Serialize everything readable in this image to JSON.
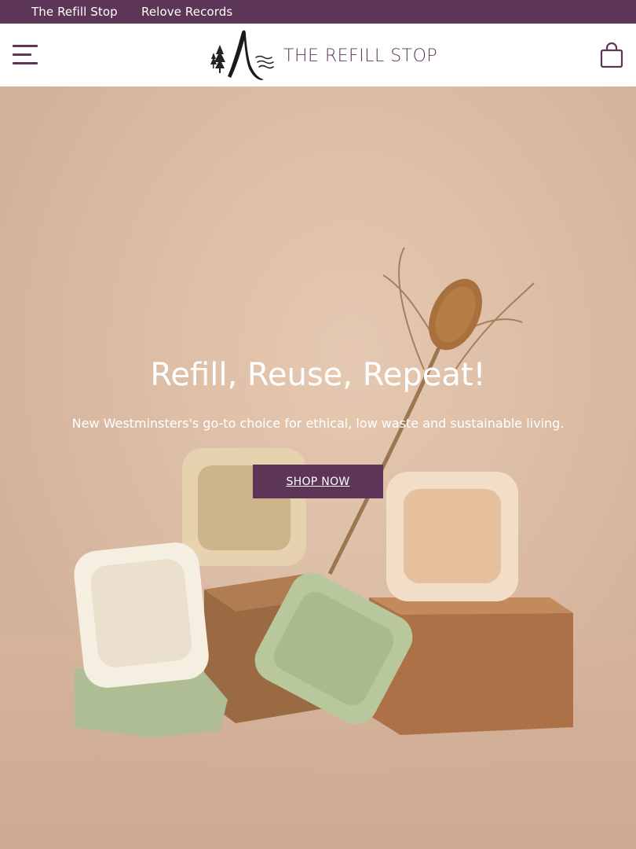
{
  "topbar": {
    "links": [
      "The Refill Stop",
      "Relove Records"
    ]
  },
  "header": {
    "brand": "THE REFILL STOP",
    "menu_icon": "hamburger-menu-icon",
    "cart_icon": "shopping-bag-icon"
  },
  "hero": {
    "title": "Refill, Reuse, Repeat!",
    "subtitle": "New Westminsters's go-to choice for ethical, low waste and sustainable living.",
    "cta_label": "SHOP NOW"
  },
  "colors": {
    "brand_purple": "#5c3557",
    "hero_background": "#d8b8a0"
  }
}
